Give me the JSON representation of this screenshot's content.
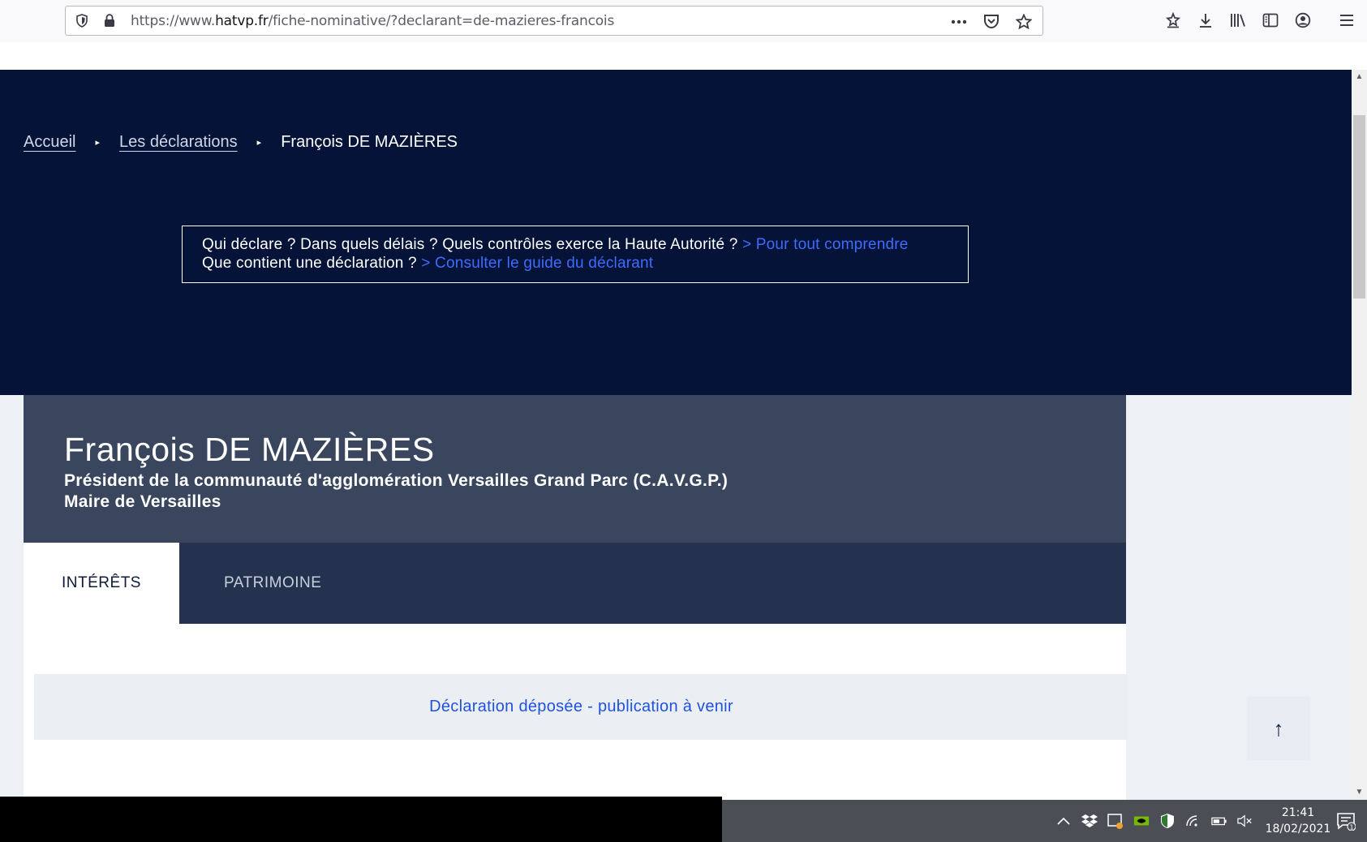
{
  "browser": {
    "url_prefix": "https://www.",
    "url_host": "hatvp.fr",
    "url_path": "/fiche-nominative/?declarant=de-mazieres-francois",
    "icons": [
      "shield-icon",
      "lock-icon",
      "more-icon",
      "pocket-icon",
      "bookmark-star-icon",
      "reading-list-icon",
      "download-icon",
      "library-icon",
      "sidebar-icon",
      "account-icon",
      "menu-icon"
    ]
  },
  "breadcrumb": {
    "home": "Accueil",
    "declarations": "Les déclarations",
    "current": "François DE MAZIÈRES",
    "separator": "▸"
  },
  "infobox": {
    "line1_text": "Qui déclare ? Dans quels délais ? Quels contrôles exerce la Haute Autorité ? ",
    "line1_link": "> Pour tout comprendre",
    "line2_text": "Que contient une déclaration ? ",
    "line2_link": "> Consulter le guide du déclarant"
  },
  "profile": {
    "name": "François DE MAZIÈRES",
    "role1": "Président de la communauté d'agglomération Versailles Grand Parc (C.A.V.G.P.)",
    "role2": "Maire de Versailles"
  },
  "tabs": {
    "interests": "INTÉRÊTS",
    "assets": "PATRIMOINE"
  },
  "notice": "Déclaration déposée - publication à venir",
  "back_to_top": "↑",
  "taskbar": {
    "time": "21:41",
    "date": "18/02/2021",
    "notification_count": "1"
  },
  "colors": {
    "hero_bg": "#051338",
    "profile_bg": "#39465e",
    "tabs_bg": "#24324f",
    "link_blue": "#3d6cff"
  }
}
